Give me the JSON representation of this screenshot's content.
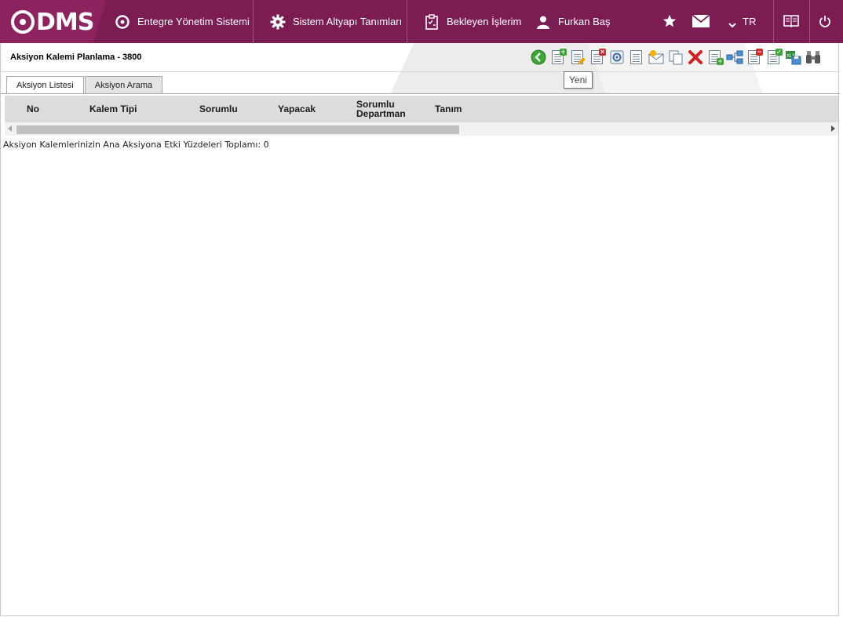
{
  "app": {
    "logo_text": "DMS"
  },
  "nav": {
    "items": [
      {
        "label": "Entegre Yönetim Sistemi",
        "icon": "qdms-circle-icon"
      },
      {
        "label": "Sistem Altyapı Tanımları",
        "icon": "gear-icon"
      },
      {
        "label": "Bekleyen İşlerim",
        "icon": "clipboard-icon"
      },
      {
        "label": "Furkan Baş",
        "icon": "user-icon"
      }
    ],
    "language": "TR"
  },
  "colors": {
    "topbar": "#7b1c52",
    "topbar_accent": "#8d2460",
    "grid_header": "#dcdcdc"
  },
  "page": {
    "title": "Aksiyon Kalemi Planlama - 3800",
    "tooltip": "Yeni"
  },
  "tabs": [
    {
      "label": "Aksiyon Listesi",
      "active": true
    },
    {
      "label": "Aksiyon Arama",
      "active": false
    }
  ],
  "grid": {
    "columns": [
      "No",
      "Kalem Tipi",
      "Sorumlu",
      "Yapacak",
      "Sorumlu Departman",
      "Tanım"
    ],
    "rows": []
  },
  "summary": "Aksiyon Kalemlerinizin Ana Aksiyona Etki Yüzdeleri Toplamı: 0"
}
